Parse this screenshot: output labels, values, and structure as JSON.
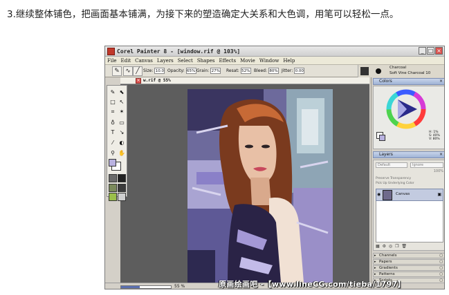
{
  "caption": "3.继续整体铺色，把画面基本铺满，为接下来的塑造确定大关系和大色调，用笔可以轻松一点。",
  "app": {
    "title": "Corel Painter 8 - [window.rif @ 103%]",
    "window_buttons": [
      "_",
      "□",
      "×"
    ],
    "menu": [
      "File",
      "Edit",
      "Canvas",
      "Layers",
      "Select",
      "Shapes",
      "Effects",
      "Movie",
      "Window",
      "Help"
    ]
  },
  "property_bar": {
    "size_label": "Size:",
    "size_value": "10.0",
    "opacity_label": "Opacity:",
    "opacity_value": "65%",
    "grain_label": "Grain:",
    "grain_value": "27%",
    "resat_label": "Resat:",
    "resat_value": "52%",
    "bleed_label": "Bleed:",
    "bleed_value": "80%",
    "jitter_label": "Jitter:",
    "jitter_value": "0.00",
    "brush_category": "Charcoal",
    "brush_variant": "Soft Vine Charcoal 10"
  },
  "document": {
    "title": "w.rif @ 55%",
    "zoom_text": "55 %",
    "zoom_fraction": 0.38
  },
  "colors_panel": {
    "title": "Colors",
    "h": "H: 1%",
    "s": "S: 40%",
    "v": "V: 80%",
    "main_color": "#b9b2e0"
  },
  "layers_panel": {
    "title": "Layers",
    "composite_method": "Default",
    "composite_depth": "Ignore",
    "opacity": "100%",
    "preserve_transparency": "Preserve Transparency",
    "pick_up_color": "Pick Up Underlying Color",
    "layer_name": "Canvas"
  },
  "collapsed_panels": [
    "Channels",
    "Papers",
    "Gradients",
    "Patterns",
    "Scripts"
  ],
  "watermark": "原画绘画吧 -【www.lineCG.com/tieba/1797】"
}
